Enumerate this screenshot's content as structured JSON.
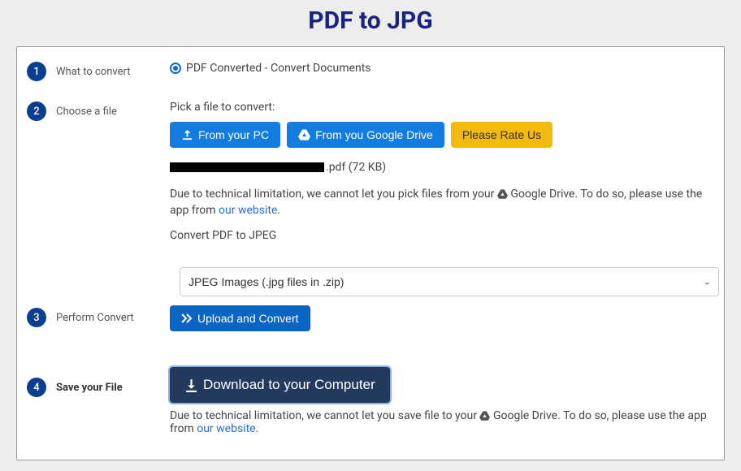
{
  "title": "PDF to JPG",
  "steps": {
    "s1": "What to convert",
    "s2": "Choose a file",
    "s3": "Perform Convert",
    "s4": "Save your File"
  },
  "radio_label": "PDF Converted - Convert Documents",
  "pick_label": "Pick a file to convert:",
  "buttons": {
    "from_pc": "From your PC",
    "from_drive": "From you Google Drive",
    "rate": "Please Rate Us",
    "upload": "Upload and Convert",
    "download": "Download to your Computer"
  },
  "file_suffix": ".pdf (72 KB)",
  "limitation_pick_pre": "Due to technical limitation, we cannot let you pick files from your ",
  "limitation_pick_drive": " Google Drive. To do so, please use the app from ",
  "our_website": "our website",
  "period": ".",
  "convert_label": "Convert PDF to JPEG",
  "select_value": "JPEG Images (.jpg files in .zip)",
  "limitation_save_pre": "Due to technical limitation, we cannot let you save file to your ",
  "limitation_save_drive": " Google Drive. To do so, please use the app from "
}
